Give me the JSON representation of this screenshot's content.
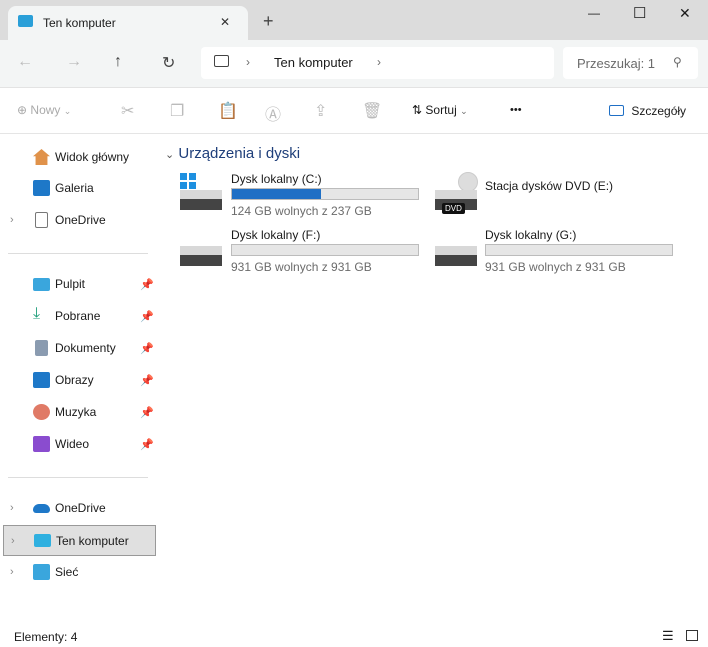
{
  "window": {
    "tab_title": "Ten komputer",
    "new_tab": "+",
    "minimize": "—",
    "maximize": "☐",
    "close": "✕"
  },
  "nav": {
    "breadcrumb": [
      "Ten komputer"
    ],
    "search_placeholder": "Przeszukaj: 1"
  },
  "toolbar": {
    "new_label": "Nowy",
    "sort_label": "Sortuj",
    "more": "•••",
    "details_label": "Szczegóły"
  },
  "sidebar": {
    "top": [
      {
        "label": "Widok główny",
        "icon": "home-icon"
      },
      {
        "label": "Galeria",
        "icon": "gallery-icon"
      },
      {
        "label": "OneDrive",
        "icon": "file-icon",
        "expandable": true
      }
    ],
    "pinned": [
      {
        "label": "Pulpit",
        "icon": "desktop-icon"
      },
      {
        "label": "Pobrane",
        "icon": "download-icon"
      },
      {
        "label": "Dokumenty",
        "icon": "documents-icon"
      },
      {
        "label": "Obrazy",
        "icon": "pictures-icon"
      },
      {
        "label": "Muzyka",
        "icon": "music-icon"
      },
      {
        "label": "Wideo",
        "icon": "video-icon"
      }
    ],
    "bottom": [
      {
        "label": "OneDrive",
        "icon": "cloud-icon"
      },
      {
        "label": "Ten komputer",
        "icon": "computer-icon",
        "selected": true
      },
      {
        "label": "Sieć",
        "icon": "network-icon"
      }
    ]
  },
  "main": {
    "section_title": "Urządzenia i dyski",
    "drives": [
      {
        "name": "Dysk lokalny (C:)",
        "info": "124 GB wolnych z 237 GB",
        "used_fraction": 0.48
      },
      {
        "name": "Stacja dysków DVD (E:)",
        "badge": "DVD"
      },
      {
        "name": "Dysk lokalny (F:)",
        "info": "931 GB wolnych z 931 GB",
        "used_fraction": 0.0
      },
      {
        "name": "Dysk lokalny (G:)",
        "info": "931 GB wolnych z 931 GB",
        "used_fraction": 0.0
      }
    ]
  },
  "status": {
    "items": "Elementy: 4"
  },
  "colors": {
    "accent": "#1f6fc5",
    "selected_bg": "#e0e0e0"
  }
}
